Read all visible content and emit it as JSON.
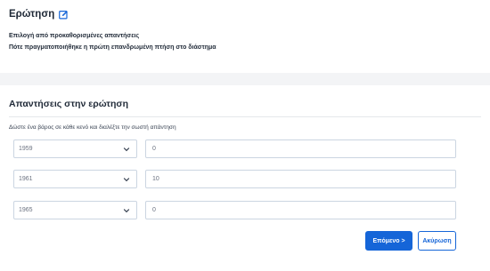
{
  "question": {
    "title": "Ερώτηση",
    "type_text": "Επιλογή από προκαθορισμένες απαντήσεις",
    "question_text": "Πότε πραγματοποιήθηκε η πρώτη επανδρωμένη πτήση στο διάστημα"
  },
  "answers": {
    "title": "Απαντήσεις στην ερώτηση",
    "instruction": "Δώστε ένα βάρος σε κάθε κενό και διαλέξτε την σωστή απάντηση",
    "rows": [
      {
        "option": "1959",
        "weight": "0"
      },
      {
        "option": "1961",
        "weight": "10"
      },
      {
        "option": "1965",
        "weight": "0"
      }
    ]
  },
  "buttons": {
    "next_label": "Επόμενο >",
    "cancel_label": "Ακύρωση"
  },
  "colors": {
    "accent": "#1565d8"
  },
  "icons": {
    "edit": "edit-icon",
    "dropdown": "chevron-down-icon"
  }
}
